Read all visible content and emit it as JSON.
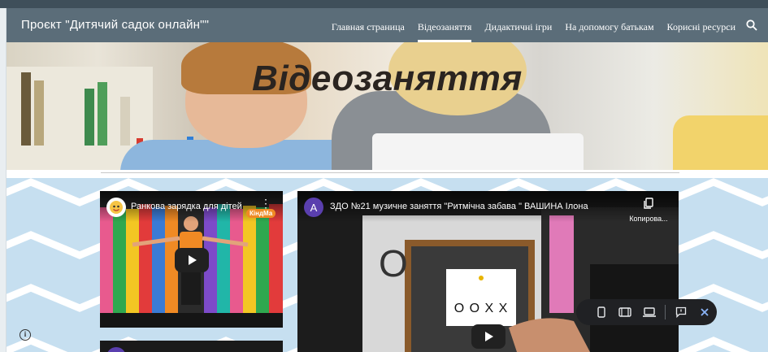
{
  "header": {
    "site_title": "Проєкт \"Дитячий садок онлайн\"\"",
    "nav": [
      {
        "label": "Главная страница",
        "active": false
      },
      {
        "label": "Відеозаняття",
        "active": true
      },
      {
        "label": "Дидактичні ігри",
        "active": false
      },
      {
        "label": "На допомогу батькам",
        "active": false
      },
      {
        "label": "Корисні ресурси",
        "active": false
      }
    ],
    "search_icon": "search-icon"
  },
  "hero": {
    "title": "Відеозаняття"
  },
  "videos": [
    {
      "title": "Ранкова зарядка для дітей",
      "channel_icon": "channel-logo-icon",
      "overlay_brand": "КіндМа"
    },
    {
      "channel_initial": "A",
      "title": "ЗДО №21 музичне заняття \"Ритмічна забава \" ВАШИНА Ілона",
      "copy_label": "Копирова...",
      "board_text": "O O X X",
      "side_letter": "O"
    }
  ],
  "toolbar": {
    "icons": [
      "phone-view-icon",
      "tablet-view-icon",
      "laptop-view-icon",
      "feedback-icon",
      "close-icon"
    ]
  },
  "colors": {
    "nav_bg": "#5b6d79",
    "content_bg": "#c6dff0",
    "toolbar_bg": "#202124",
    "toolbar_accent": "#8ab4f8",
    "channel_avatar": "#5a3fae"
  },
  "info_icon": "i"
}
